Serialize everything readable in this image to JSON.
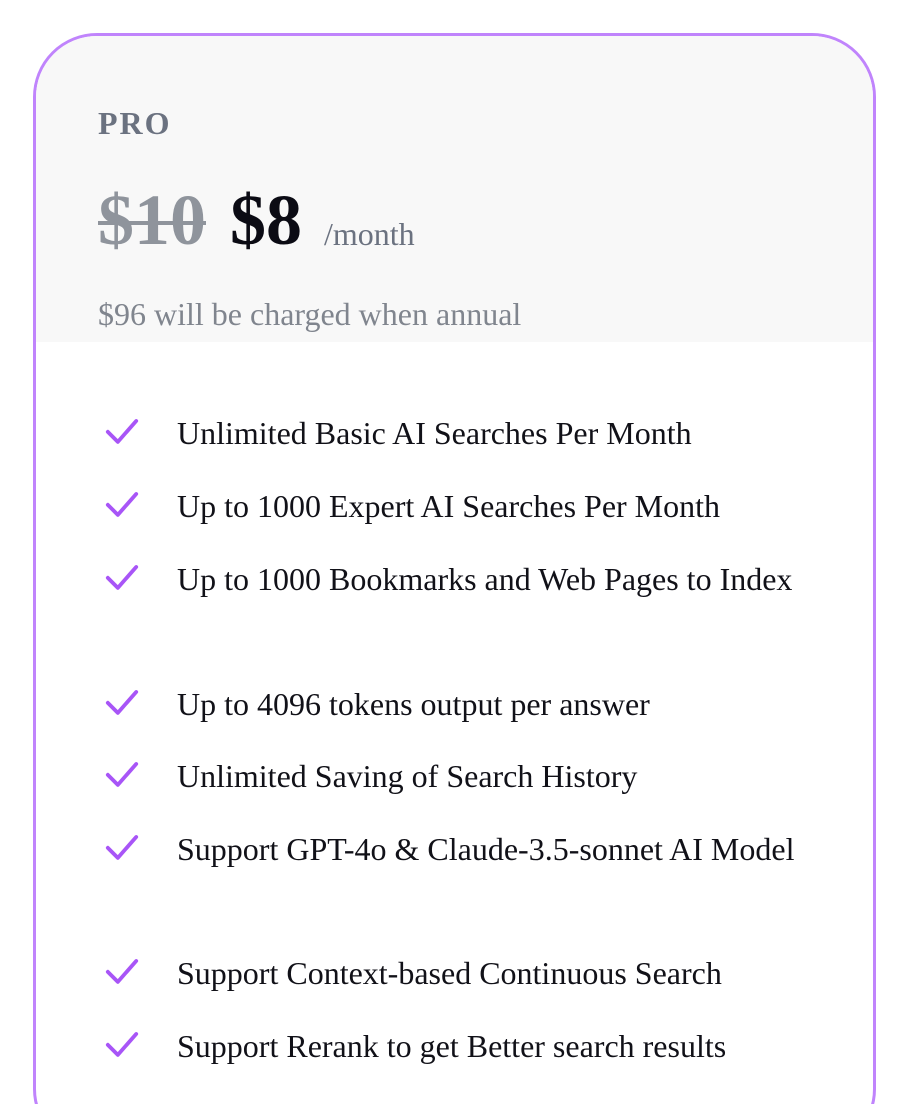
{
  "plan": {
    "name": "PRO",
    "old_price": "$10",
    "price": "$8",
    "period": "/month",
    "annual_note": "$96 will be charged when annual"
  },
  "features": [
    "Unlimited Basic AI Searches Per Month",
    "Up to 1000 Expert AI Searches Per Month",
    "Up to 1000 Bookmarks and Web Pages to Index",
    "Up to 4096 tokens output per answer",
    "Unlimited Saving of Search History",
    "Support GPT-4o & Claude-3.5-sonnet AI Model",
    "Support Context-based Continuous Search",
    "Support Rerank to get Better search results"
  ],
  "colors": {
    "accent": "#a855f7",
    "border": "#c084fc",
    "header_bg": "#f8f8f8"
  }
}
